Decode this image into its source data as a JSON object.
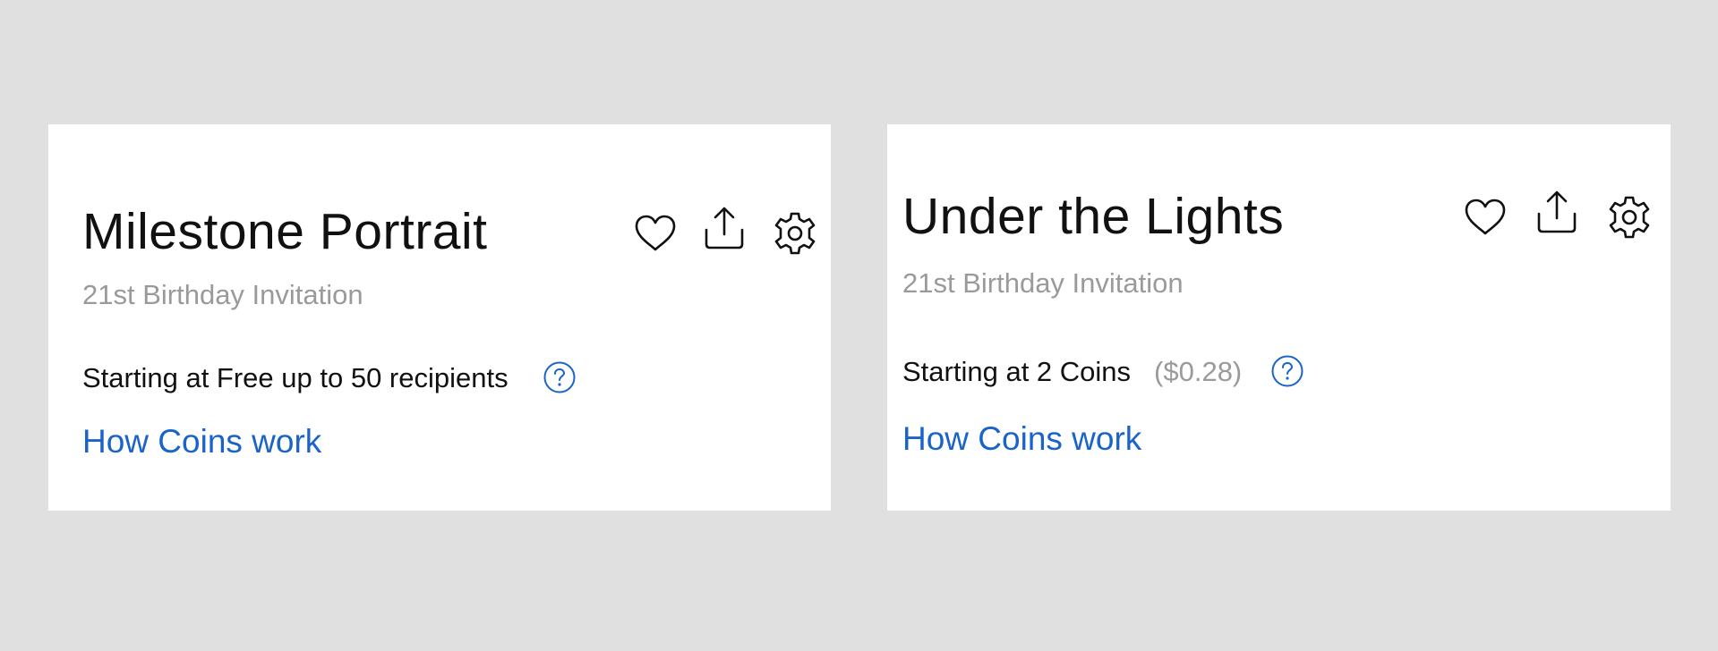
{
  "cards": [
    {
      "title": "Milestone Portrait",
      "subtitle": "21st Birthday Invitation",
      "price_text": "Starting at Free up to 50 recipients",
      "price_sub": "",
      "link_text": "How Coins work",
      "icons": [
        "heart-icon",
        "share-icon",
        "gear-icon",
        "help-icon"
      ]
    },
    {
      "title": "Under the Lights",
      "subtitle": "21st Birthday Invitation",
      "price_text": "Starting at 2 Coins",
      "price_sub": "($0.28)",
      "link_text": "How Coins work",
      "icons": [
        "heart-icon",
        "share-icon",
        "gear-icon",
        "help-icon"
      ]
    }
  ],
  "colors": {
    "background": "#e0e0e0",
    "card": "#ffffff",
    "title": "#111111",
    "muted": "#9a9a9a",
    "link": "#1a63c8"
  }
}
